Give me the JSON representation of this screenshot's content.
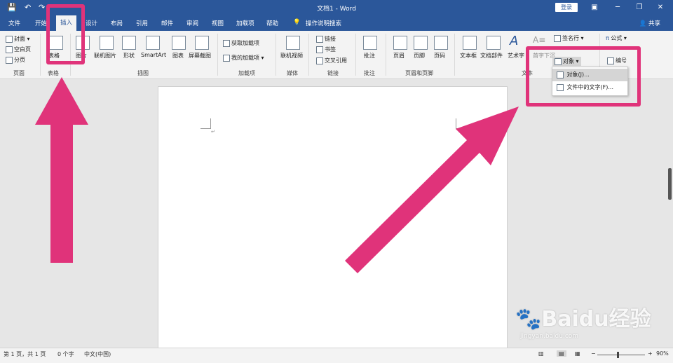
{
  "window": {
    "title": "文档1 - Word",
    "login_label": "登录"
  },
  "tabs": {
    "file": "文件",
    "home": "开始",
    "insert": "插入",
    "design": "设计",
    "layout": "布局",
    "references": "引用",
    "mailings": "邮件",
    "review": "审阅",
    "view": "视图",
    "addins": "加载项",
    "help": "帮助",
    "tell_me": "操作说明搜索",
    "share": "共享"
  },
  "ribbon": {
    "pages": {
      "cover": "封面",
      "blank": "空白页",
      "break": "分页",
      "label": "页面"
    },
    "tables": {
      "table": "表格",
      "label": "表格"
    },
    "illustrations": {
      "pictures": "图片",
      "online_pictures": "联机图片",
      "shapes": "形状",
      "smartart": "SmartArt",
      "chart": "图表",
      "screenshot": "屏幕截图",
      "label": "插图"
    },
    "addins": {
      "get": "获取加载项",
      "my": "我的加载项",
      "label": "加载项"
    },
    "media": {
      "online_video": "联机视频",
      "label": "媒体"
    },
    "links": {
      "link": "链接",
      "bookmark": "书签",
      "cross_ref": "交叉引用",
      "label": "链接"
    },
    "comments": {
      "comment": "批注",
      "label": "批注"
    },
    "header_footer": {
      "header": "页眉",
      "footer": "页脚",
      "page_number": "页码",
      "label": "页眉和页脚"
    },
    "text": {
      "textbox": "文本框",
      "quickparts": "文档部件",
      "wordart": "艺术字",
      "dropcap": "首字下沉",
      "signature": "签名行",
      "object": "对象",
      "label": "文本"
    },
    "symbols": {
      "equation": "公式",
      "number": "编号"
    }
  },
  "object_menu": {
    "object": "对象(J)...",
    "text_from_file": "文件中的文字(F)..."
  },
  "status": {
    "page": "第 1 页，共 1 页",
    "words": "0 个字",
    "language": "中文(中国)",
    "zoom": "90%"
  },
  "watermark": {
    "brand": "Baidu经验",
    "url": "jingyan.baidu.com"
  },
  "colors": {
    "accent": "#2b579a",
    "annotation": "#e0337a"
  }
}
